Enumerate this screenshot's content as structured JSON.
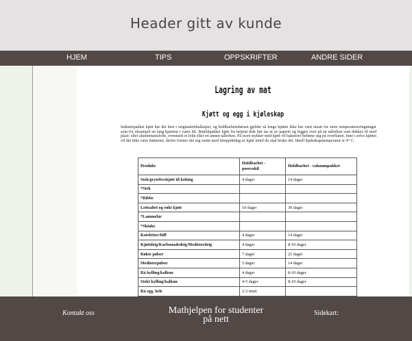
{
  "header": {
    "title": "Header gitt av kunde"
  },
  "nav": {
    "items": [
      "HJEM",
      "TIPS",
      "OPPSKRIFTER",
      "ANDRE SIDER"
    ]
  },
  "document": {
    "title": "Lagring av mat",
    "subtitle": "Kjøtt og egg i kjøleskap",
    "body": "Industripakket kjøtt har det best i originalemballasjen, og holdbarhetsdatoen gjelder så lenge kjøttet ikke har vært utsatt for store temperatursvingninger som for eksempel en lang kjøretur i varm bil. Butikkpakket kjøtt fra betjent disk bør tas ut av papiret og legges over på en tallerken som dekkes til med plast- eller aluminiumsfolie, eventuelt et lokk eller en annen tallerken. På store stykker med kjøtt vil bakterier befinne seg på overflaten. Inne i selve kjøttet vil det ikke være bakterier, derfor former det seg vente med finoppdeling av kjøtt inntil du skal bruke det. Ideell kjøleskapstemperatur er 4° C.",
    "table": {
      "headers": [
        "Produkt",
        "Holdbarhet - posevakil",
        "Holdbarhet - vakuumpakket"
      ],
      "rows": [
        [
          "Stek/gryteferskjøtt til koking",
          "4 dager",
          "14 dager"
        ],
        [
          "*Stek",
          "",
          ""
        ],
        [
          "*Ribbe",
          "",
          ""
        ],
        [
          "Lettsaltet og røkt kjøtt",
          "10 dager",
          "30 dager"
        ],
        [
          "*Lammelår",
          "",
          ""
        ],
        [
          "*Skinke",
          "",
          ""
        ],
        [
          "Koteletter/biff",
          "4 dager",
          "14 dager"
        ],
        [
          "Kjøttdeig/Karbonadedeig/Medisterdeig",
          "4 dager",
          "8-10 dager"
        ],
        [
          "Røkte pølser",
          "7 dager",
          "21 dager"
        ],
        [
          "Medisterpølser",
          "5 dager",
          "14 dager"
        ],
        [
          "Rå kylling/kalkun",
          "4 dager",
          "8-10 dager"
        ],
        [
          "Stekt kylling/kalkun",
          "4-5 dager",
          "8-10 dager"
        ],
        [
          "Rå egg, hele",
          "2-3 mnd.",
          ""
        ],
        [
          "",
          "2 dager",
          ""
        ]
      ]
    }
  },
  "footer": {
    "contact": "Kontakt oss",
    "center_line1": "Mathjelpen for studenter",
    "center_line2": "på nett",
    "sitemap": "Sidekart:"
  }
}
